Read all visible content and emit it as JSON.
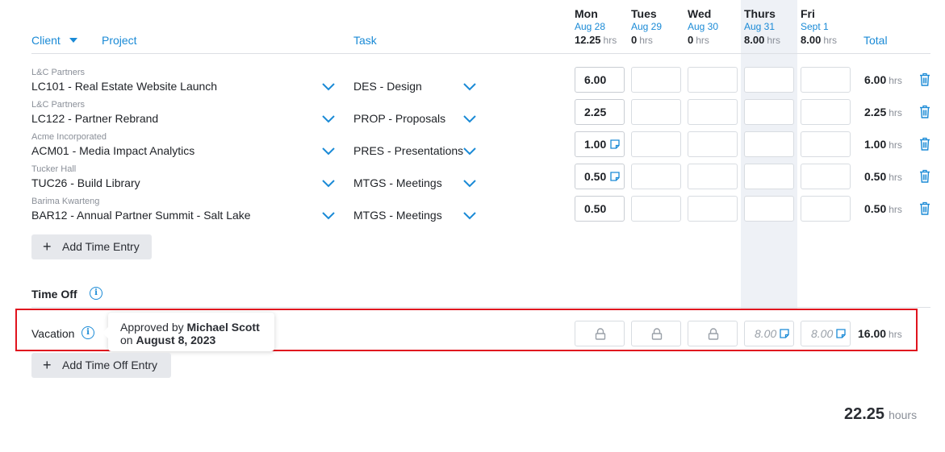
{
  "header": {
    "client_label": "Client",
    "project_label": "Project",
    "task_label": "Task",
    "total_label": "Total",
    "hrs_unit": "hrs",
    "days": [
      {
        "name": "Mon",
        "date": "Aug 28",
        "hours": "12.25"
      },
      {
        "name": "Tues",
        "date": "Aug 29",
        "hours": "0"
      },
      {
        "name": "Wed",
        "date": "Aug 30",
        "hours": "0"
      },
      {
        "name": "Thurs",
        "date": "Aug 31",
        "hours": "8.00"
      },
      {
        "name": "Fri",
        "date": "Sept 1",
        "hours": "8.00"
      }
    ]
  },
  "entries": [
    {
      "client": "L&C Partners",
      "project": "LC101 - Real Estate Website Launch",
      "task": "DES - Design",
      "mon": "6.00",
      "mon_note": false,
      "total": "6.00"
    },
    {
      "client": "L&C Partners",
      "project": "LC122 - Partner Rebrand",
      "task": "PROP - Proposals",
      "mon": "2.25",
      "mon_note": false,
      "total": "2.25"
    },
    {
      "client": "Acme Incorporated",
      "project": "ACM01 - Media Impact Analytics",
      "task": "PRES - Presentations",
      "mon": "1.00",
      "mon_note": true,
      "total": "1.00"
    },
    {
      "client": "Tucker Hall",
      "project": "TUC26 - Build Library",
      "task": "MTGS - Meetings",
      "mon": "0.50",
      "mon_note": true,
      "total": "0.50"
    },
    {
      "client": "Barima Kwarteng",
      "project": "BAR12 - Annual Partner Summit - Salt Lake",
      "task": "MTGS - Meetings",
      "mon": "0.50",
      "mon_note": false,
      "total": "0.50"
    }
  ],
  "add_time_entry_label": "Add Time Entry",
  "time_off": {
    "title": "Time Off",
    "vacation": {
      "label": "Vacation",
      "thu": "8.00",
      "fri": "8.00",
      "total": "16.00"
    },
    "tooltip": {
      "prefix": "Approved by",
      "approver": "Michael Scott",
      "on": "on",
      "date": "August 8, 2023"
    },
    "add_label": "Add Time Off Entry"
  },
  "grand_total": {
    "value": "22.25",
    "unit": "hours"
  },
  "colors": {
    "accent": "#1a8ad6",
    "highlight": "#e0141e",
    "today_bg": "#eef1f6"
  }
}
